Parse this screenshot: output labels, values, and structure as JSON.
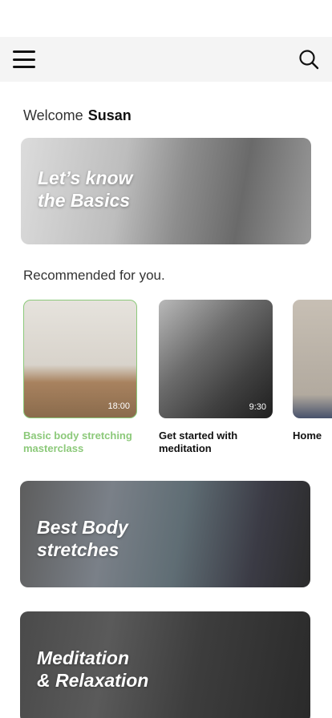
{
  "header": {
    "menu_icon": "hamburger-menu-icon",
    "search_icon": "search-icon"
  },
  "welcome": {
    "greeting": "Welcome",
    "user_name": "Susan"
  },
  "hero_banner": {
    "title_line1": "Let’s know",
    "title_line2": "the Basics"
  },
  "recommended": {
    "title": "Recommended for you.",
    "items": [
      {
        "title": "Basic body stretching masterclass",
        "duration": "18:00"
      },
      {
        "title": "Get started with meditation",
        "duration": "9:30"
      },
      {
        "title": "Home"
      }
    ]
  },
  "banners": [
    {
      "title_line1": "Best Body",
      "title_line2": "stretches"
    },
    {
      "title_line1": "Meditation",
      "title_line2": "& Relaxation"
    }
  ],
  "colors": {
    "accent_green": "#8cc97a",
    "appbar_bg": "#f4f4f4"
  }
}
